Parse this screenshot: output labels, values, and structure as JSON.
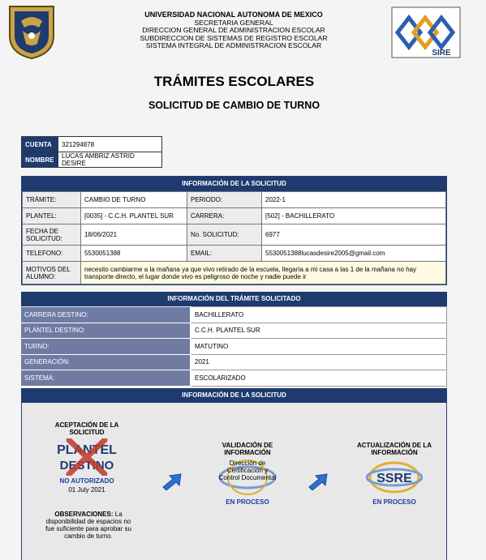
{
  "institution": {
    "line1": "UNIVERSIDAD NACIONAL AUTONOMA DE MEXICO",
    "line2": "SECRETARIA GENERAL",
    "line3": "DIRECCION GENERAL DE ADMINISTRACION ESCOLAR",
    "line4": "SUBDIRECCION DE SISTEMAS DE REGISTRO ESCOLAR",
    "line5": "SISTEMA INTEGRAL DE ADMINISTRACION ESCOLAR",
    "sire_logo_text": "SIRE"
  },
  "page": {
    "title": "TRÁMITES ESCOLARES",
    "subtitle": "SOLICITUD DE CAMBIO DE TURNO"
  },
  "student": {
    "cuenta_label": "CUENTA",
    "cuenta": "321294878",
    "nombre_label": "NOMBRE",
    "nombre": "LUCAS AMBRIZ ASTRID DESIRE"
  },
  "solicitud": {
    "header": "INFORMACIÓN DE LA SOLICITUD",
    "tramite_label": "TRÁMITE:",
    "tramite": "CAMBIO DE TURNO",
    "periodo_label": "PERIODO:",
    "periodo": "2022-1",
    "plantel_label": "PLANTEL:",
    "plantel": "[0035] - C.C.H. PLANTEL SUR",
    "carrera_label": "CARRERA:",
    "carrera": "[502] - BACHILLERATO",
    "fecha_label": "FECHA DE SOLICITUD:",
    "fecha": "18/06/2021",
    "num_label": "No. SOLICITUD:",
    "num": "6977",
    "telefono_label": "TELEFONO:",
    "telefono": "5530051388",
    "email_label": "EMAIL:",
    "email": "5530051388lucasdesire2005@gmail.com",
    "motivos_label": "MOTIVOS DEL ALUMNO:",
    "motivos": "necesito cambiarme a la mañana ya que vivo retirado de la escuela, llegaría a mi casa a las 1 de la mañana no hay transporte directo, el lugar donde vivo es peligroso de noche y nadie puede ir"
  },
  "tramite": {
    "header": "INFORMACIÓN DEL TRÁMITE SOLICITADO",
    "rows": [
      {
        "label": "CARRERA DESTINO:",
        "value": "BACHILLERATO"
      },
      {
        "label": "PLANTEL DESTINO:",
        "value": "C.C.H. PLANTEL SUR"
      },
      {
        "label": "TURNO:",
        "value": "MATUTINO"
      },
      {
        "label": "GENERACIÓN:",
        "value": "2021"
      },
      {
        "label": "SISTEMA:",
        "value": "ESCOLARIZADO"
      }
    ]
  },
  "status": {
    "header": "INFORMACIÓN DE LA SOLICITUD",
    "step1_title": "ACEPTACIÓN DE LA SOLICITUD",
    "step1_logo_line1": "PLANTEL",
    "step1_logo_line2": "DESTINO",
    "step1_status": "NO AUTORIZADO",
    "step1_date": "01 July 2021",
    "obs_label": "OBSERVACIONES:",
    "obs_text": "La disponibilidad de espacios no fue suficiente para aprobar su cambio de turno.",
    "step2_title": "VALIDACIÓN DE INFORMACIÓN",
    "step2_logo_text": "Dirección de Certificación y Control Documental",
    "step2_status": "EN PROCESO",
    "step3_title": "ACTUALIZACIÓN DE LA INFORMACIÓN",
    "step3_logo_text": "SSRE",
    "step3_status": "EN PROCESO",
    "colors": {
      "blue_status": "#1c3aa8",
      "header_navy": "#1e3a6e",
      "denied_x": "#c0392b"
    }
  }
}
